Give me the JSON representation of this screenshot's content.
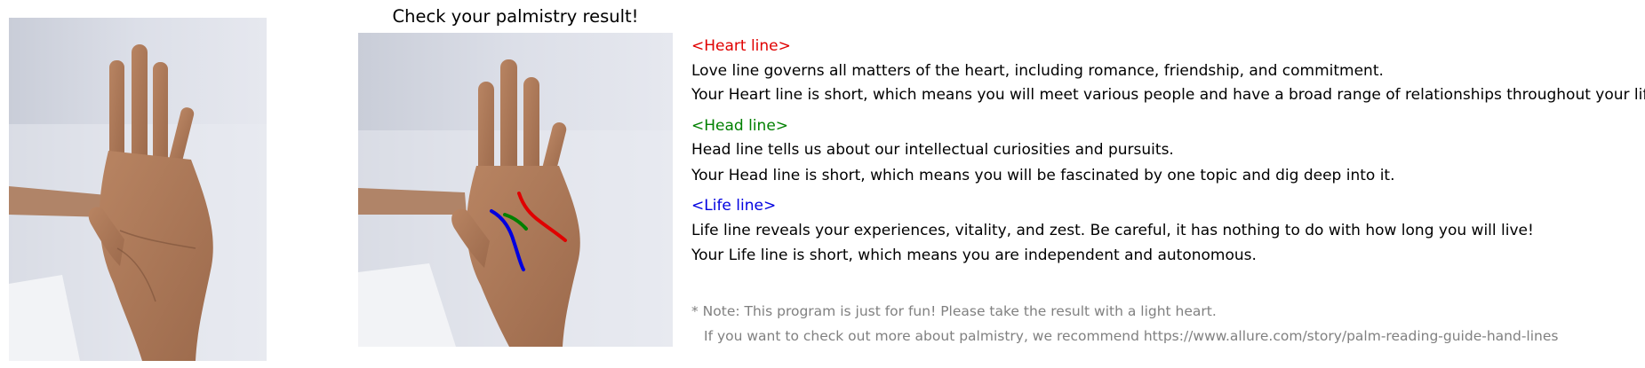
{
  "title": "Check your palmistry result!",
  "images": {
    "original": {
      "icon": "hand-photo"
    },
    "result": {
      "icon": "hand-photo-with-palm-lines"
    }
  },
  "colors": {
    "heart": "#e00000",
    "head": "#008000",
    "life": "#0000e0",
    "note": "#808080"
  },
  "heart": {
    "heading": "<Heart line>",
    "desc": "Love line governs all matters of the heart, including romance, friendship, and commitment.",
    "result": "Your Heart line is short, which means you will meet various people and have a broad range of relationships throughout your life."
  },
  "head": {
    "heading": "<Head line>",
    "desc": "Head line tells us about our intellectual curiosities and pursuits.",
    "result": "Your Head line is short, which means you will be fascinated by one topic and dig deep into it."
  },
  "life": {
    "heading": "<Life line>",
    "desc": "Life line reveals your experiences, vitality, and zest. Be careful, it has nothing to do with how long you will live!",
    "result": "Your Life line is short, which means you are independent and autonomous."
  },
  "note": {
    "line1": "* Note: This program is just for fun! Please take the result with a light heart.",
    "line2": "If you want to check out more about palmistry, we recommend https://www.allure.com/story/palm-reading-guide-hand-lines"
  }
}
